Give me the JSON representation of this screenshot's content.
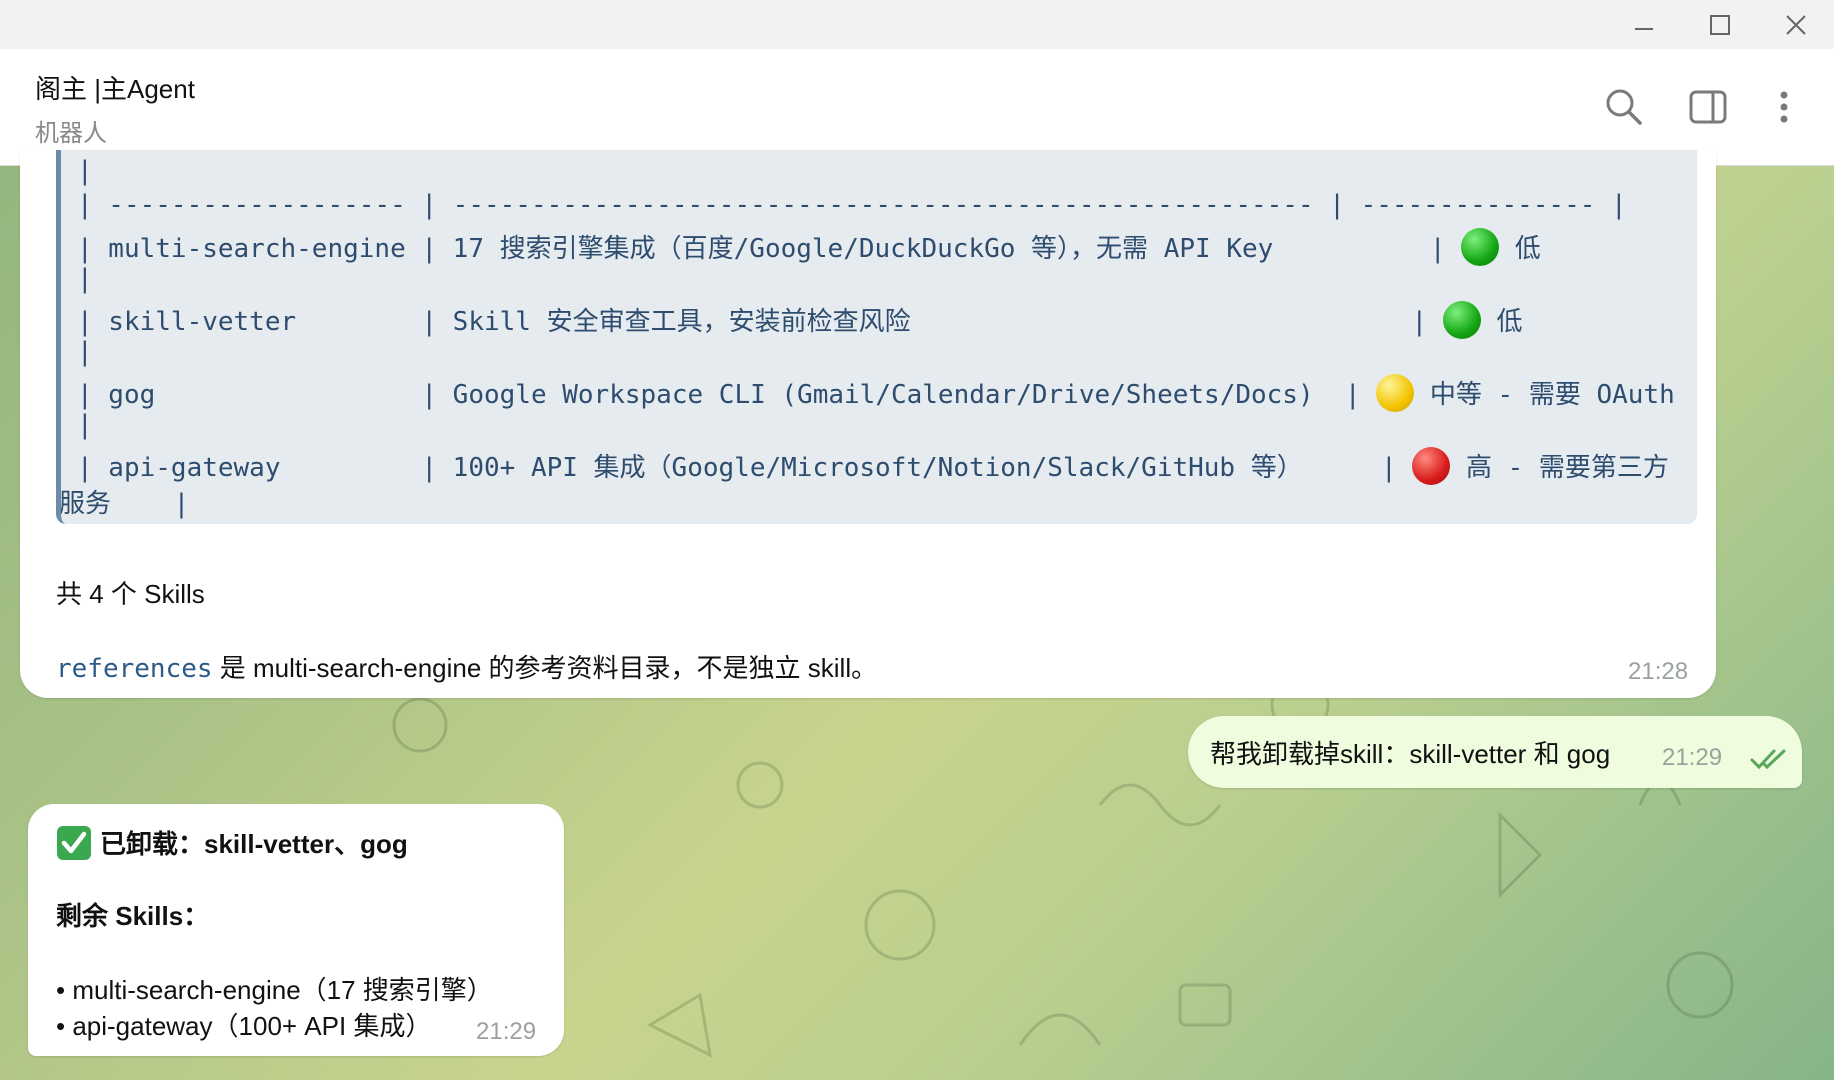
{
  "window": {
    "minimize_icon": "minimize-icon",
    "maximize_icon": "maximize-icon",
    "close_icon": "close-icon"
  },
  "header": {
    "title": "阁主 |主Agent",
    "subtitle": "机器人",
    "icons": [
      "search-icon",
      "sidebar-toggle-icon",
      "more-vertical-icon"
    ]
  },
  "messages": {
    "skills_table": {
      "top_pipe": "|",
      "separator": "| ------------------- | ------------------------------------------------------- | --------------- |",
      "rows": [
        {
          "text": "| multi-search-engine | 17 搜索引擎集成（百度/Google/DuckDuckGo 等），无需 API Key          | ",
          "risk": "低",
          "color": "green",
          "cont": "|"
        },
        {
          "text": "| skill-vetter        | Skill 安全审查工具，安装前检查风险                                | ",
          "risk": "低",
          "color": "green",
          "cont": "|"
        },
        {
          "text": "| gog                 | Google Workspace CLI (Gmail/Calendar/Drive/Sheets/Docs)  | ",
          "risk": "中等 - 需要 OAuth",
          "color": "yellow",
          "cont": "|"
        },
        {
          "text": "| api-gateway         | 100+ API 集成（Google/Microsoft/Notion/Slack/GitHub 等）     | ",
          "risk": "高 - 需要第三方",
          "color": "red",
          "cont": "服务    |"
        }
      ],
      "total": "共 4 个 Skills",
      "references_code": "references",
      "references_text": " 是 multi-search-engine 的参考资料目录，不是独立 skill。",
      "time": "21:28"
    },
    "outgoing": {
      "text": "帮我卸载掉skill：skill-vetter 和 gog",
      "time": "21:29",
      "read_icon": "double-check-icon"
    },
    "reply": {
      "check_icon": "check-box-icon",
      "line1": "已卸载：skill-vetter、gog",
      "line2": "剩余 Skills：",
      "line3": "• multi-search-engine（17 搜索引擎）",
      "line4": "• api-gateway（100+ API 集成）",
      "time": "21:29"
    }
  },
  "colors": {
    "risk_low": "#13a513",
    "risk_medium": "#f2c300",
    "risk_high": "#d81b1b",
    "outgoing_bubble": "#effdde"
  }
}
